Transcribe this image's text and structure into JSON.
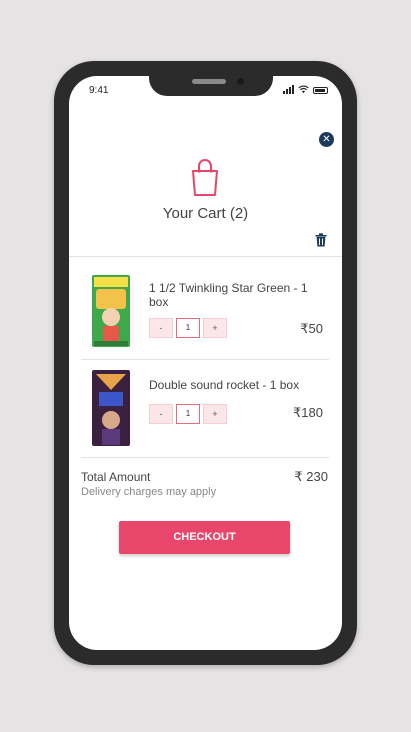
{
  "status_bar": {
    "time": "9:41"
  },
  "header": {
    "title": "Your Cart (2)"
  },
  "cart": {
    "items": [
      {
        "name": "1 1/2 Twinkling Star Green - 1 box",
        "quantity": "1",
        "price": "₹50",
        "minus": "-",
        "plus": "+"
      },
      {
        "name": "Double sound rocket - 1 box",
        "quantity": "1",
        "price": "₹180",
        "minus": "-",
        "plus": "+"
      }
    ]
  },
  "summary": {
    "total_label": "Total Amount",
    "delivery_note": "Delivery charges may apply",
    "total_value": "₹ 230"
  },
  "checkout": {
    "label": "CHECKOUT"
  },
  "colors": {
    "accent": "#e8466a",
    "close": "#1c3b5a"
  },
  "icons": [
    "close-icon",
    "shopping-bag-icon",
    "trash-icon",
    "signal-icon",
    "wifi-icon",
    "battery-icon"
  ]
}
